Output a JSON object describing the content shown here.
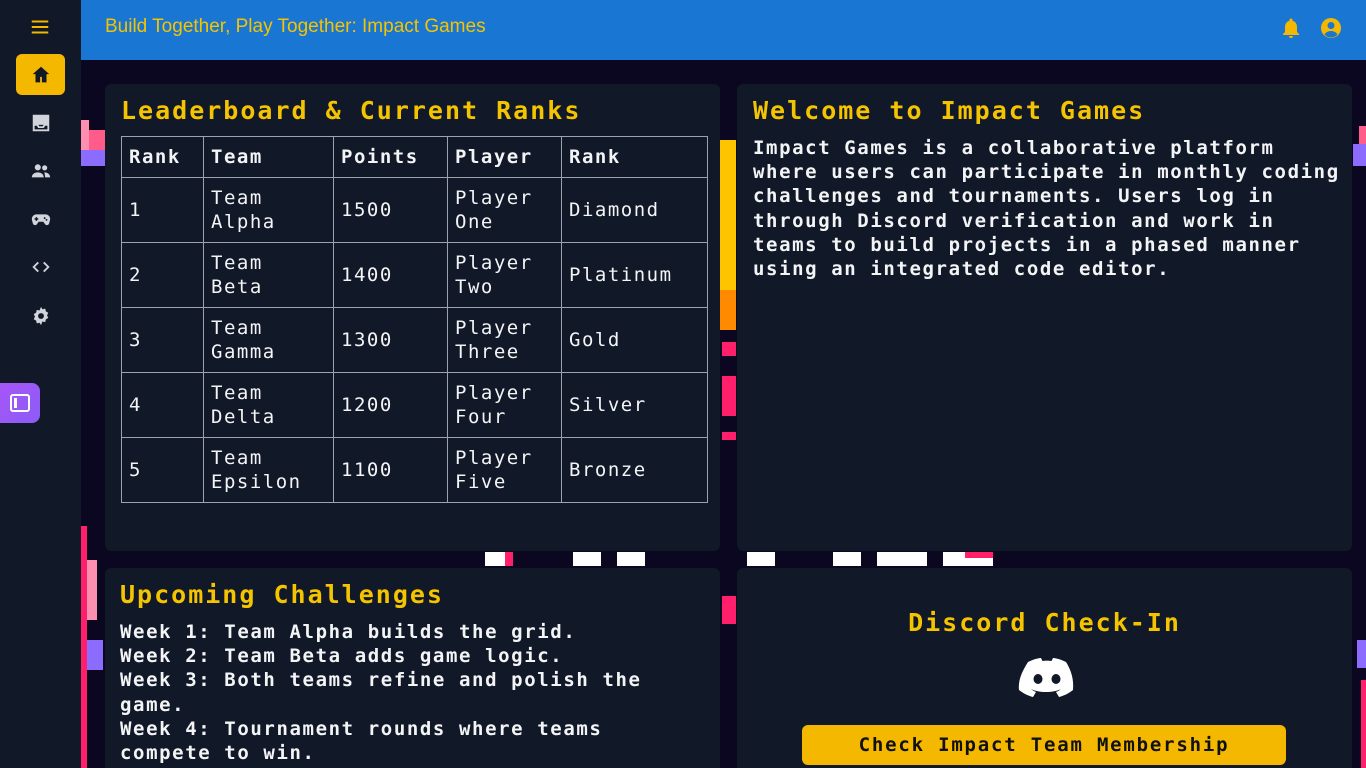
{
  "header": {
    "title": "Build Together, Play Together: Impact Games",
    "notification_icon": "bell-icon",
    "account_icon": "account-circle-icon"
  },
  "sidebar": {
    "menu_icon": "hamburger-icon",
    "items": [
      {
        "name": "home",
        "icon": "home-icon",
        "active": true
      },
      {
        "name": "inbox",
        "icon": "inbox-icon",
        "active": false
      },
      {
        "name": "teams",
        "icon": "people-icon",
        "active": false
      },
      {
        "name": "games",
        "icon": "gamepad-icon",
        "active": false
      },
      {
        "name": "code",
        "icon": "code-icon",
        "active": false
      },
      {
        "name": "settings",
        "icon": "gear-icon",
        "active": false
      }
    ],
    "extension_icon": "sidebar-panel-icon"
  },
  "leaderboard": {
    "title": "Leaderboard & Current Ranks",
    "columns": [
      "Rank",
      "Team",
      "Points",
      "Player",
      "Rank"
    ],
    "rows": [
      [
        "1",
        "Team Alpha",
        "1500",
        "Player One",
        "Diamond"
      ],
      [
        "2",
        "Team Beta",
        "1400",
        "Player Two",
        "Platinum"
      ],
      [
        "3",
        "Team Gamma",
        "1300",
        "Player Three",
        "Gold"
      ],
      [
        "4",
        "Team Delta",
        "1200",
        "Player Four",
        "Silver"
      ],
      [
        "5",
        "Team Epsilon",
        "1100",
        "Player Five",
        "Bronze"
      ]
    ]
  },
  "welcome": {
    "title": "Welcome to Impact Games",
    "body": "Impact Games is a collaborative platform where users can participate in monthly coding challenges and tournaments. Users log in through Discord verification and work in teams to build projects in a phased manner using an integrated code editor."
  },
  "challenges": {
    "title": "Upcoming Challenges",
    "items": [
      "Week 1: Team Alpha builds the grid.",
      "Week 2: Team Beta adds game logic.",
      "Week 3: Both teams refine and polish the game.",
      "Week 4: Tournament rounds where teams compete to win."
    ]
  },
  "discord": {
    "title": "Discord Check-In",
    "icon": "discord-icon",
    "button_label": "Check Impact Team Membership"
  },
  "colors": {
    "accent": "#f5b800",
    "header_bg": "#1976d2",
    "card_bg": "#111827",
    "page_bg": "#0b0720",
    "pixel_pink": "#ff1f6a",
    "pixel_orange": "#ffb000"
  }
}
